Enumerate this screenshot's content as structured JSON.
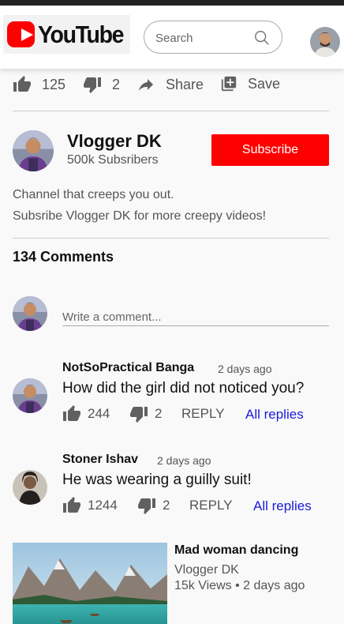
{
  "header": {
    "logo_text": "YouTube",
    "search_placeholder": "Search"
  },
  "video_actions": {
    "likes": "125",
    "dislikes": "2",
    "share_label": "Share",
    "save_label": "Save"
  },
  "channel": {
    "name": "Vlogger DK",
    "subscribers": "500k Subsribers",
    "subscribe_label": "Subscribe",
    "description_line1": "Channel that creeps you out.",
    "description_line2": "Subsribe Vlogger DK for more creepy videos!"
  },
  "comments": {
    "title": "134 Comments",
    "input_placeholder": "Write a comment...",
    "items": [
      {
        "author": "NotSoPractical Banga",
        "time": "2 days ago",
        "text": "How did the girl did not noticed you?",
        "likes": "244",
        "dislikes": "2",
        "reply_label": "REPLY",
        "all_replies_label": "All replies"
      },
      {
        "author": "Stoner Ishav",
        "time": "2 days ago",
        "text": "He was wearing a guilly suit!",
        "likes": "1244",
        "dislikes": "2",
        "reply_label": "REPLY",
        "all_replies_label": "All replies"
      }
    ]
  },
  "related": {
    "title": "Mad woman dancing",
    "channel": "Vlogger DK",
    "meta": "15k Views • 2 days ago"
  },
  "colors": {
    "brand_red": "#ff0000",
    "link_blue": "#1a1adf",
    "icon_gray": "#606060"
  }
}
